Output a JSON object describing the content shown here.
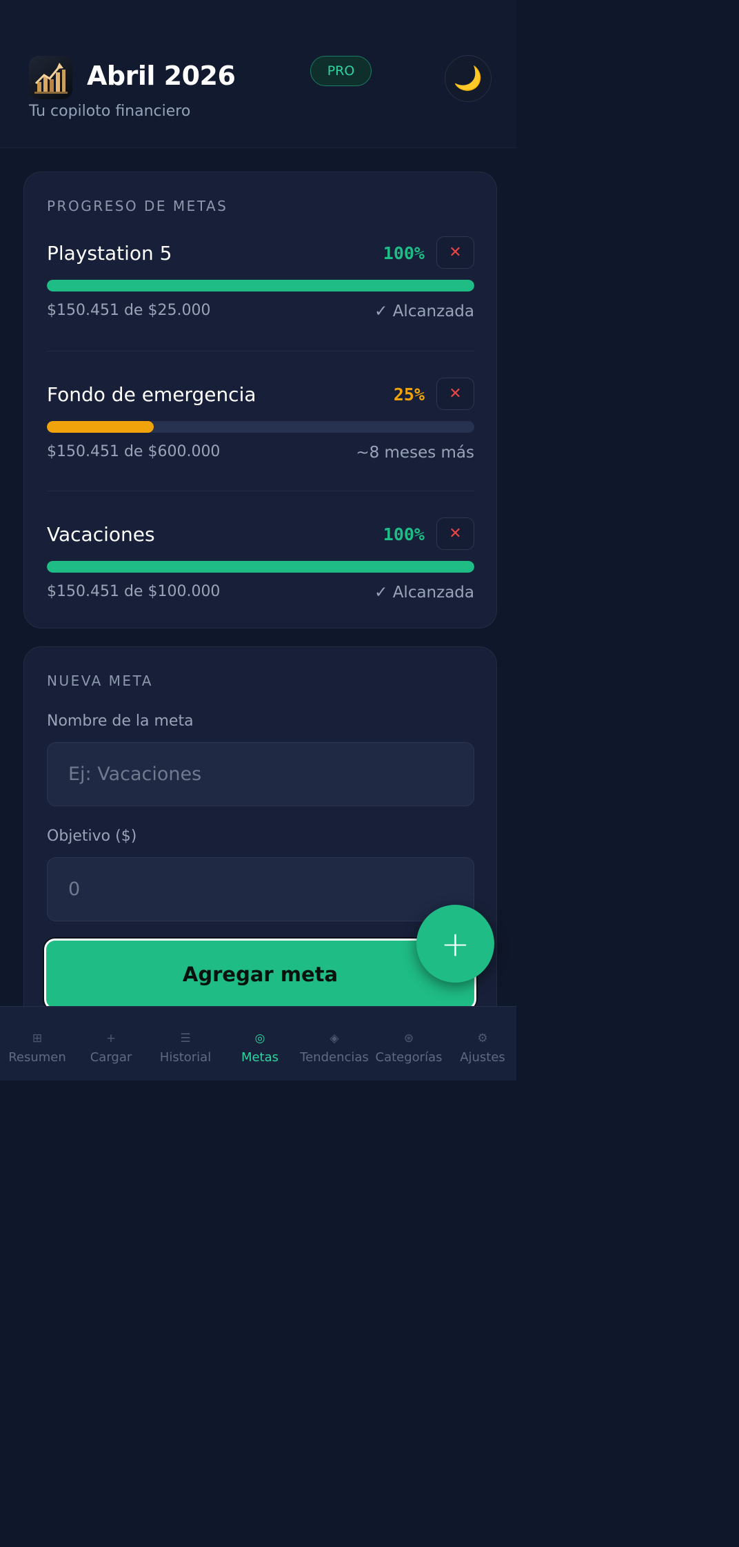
{
  "header": {
    "title": "Abril 2026",
    "subtitle": "Tu copiloto financiero",
    "badge": "PRO",
    "logo_icon": "growth-chart-icon",
    "theme_icon": "moon-icon",
    "theme_glyph": "🌙"
  },
  "goals": {
    "section_title": "PROGRESO DE METAS",
    "remove_glyph": "✕",
    "items": [
      {
        "name": "Playstation 5",
        "percent": "100%",
        "progress": 1.0,
        "amount": "$150.451 de $25.000",
        "status": "✓ Alcanzada",
        "color": "#1fbc85"
      },
      {
        "name": "Fondo de emergencia",
        "percent": "25%",
        "progress": 0.25,
        "amount": "$150.451 de $600.000",
        "status": "~8 meses más",
        "color": "#f0a30a"
      },
      {
        "name": "Vacaciones",
        "percent": "100%",
        "progress": 1.0,
        "amount": "$150.451 de $100.000",
        "status": "✓ Alcanzada",
        "color": "#1fbc85"
      }
    ]
  },
  "new_goal": {
    "section_title": "NUEVA META",
    "name_label": "Nombre de la meta",
    "name_placeholder": "Ej: Vacaciones",
    "target_label": "Objetivo ($)",
    "target_placeholder": "0",
    "submit_label": "Agregar meta"
  },
  "fab": {
    "icon": "plus-icon",
    "glyph": "+"
  },
  "nav": {
    "active_color": "#2dd4a0",
    "inactive_color": "#5f6b82",
    "items": [
      {
        "label": "Resumen",
        "glyph": "⊞",
        "icon": "grid-icon",
        "active": false
      },
      {
        "label": "Cargar",
        "glyph": "+",
        "icon": "plus-icon",
        "active": false
      },
      {
        "label": "Historial",
        "glyph": "☰",
        "icon": "list-icon",
        "active": false
      },
      {
        "label": "Metas",
        "glyph": "◎",
        "icon": "target-icon",
        "active": true
      },
      {
        "label": "Tendencias",
        "glyph": "◈",
        "icon": "trend-icon",
        "active": false
      },
      {
        "label": "Categorías",
        "glyph": "⊛",
        "icon": "categories-icon",
        "active": false
      },
      {
        "label": "Ajustes",
        "glyph": "⚙",
        "icon": "gear-icon",
        "active": false
      }
    ]
  }
}
